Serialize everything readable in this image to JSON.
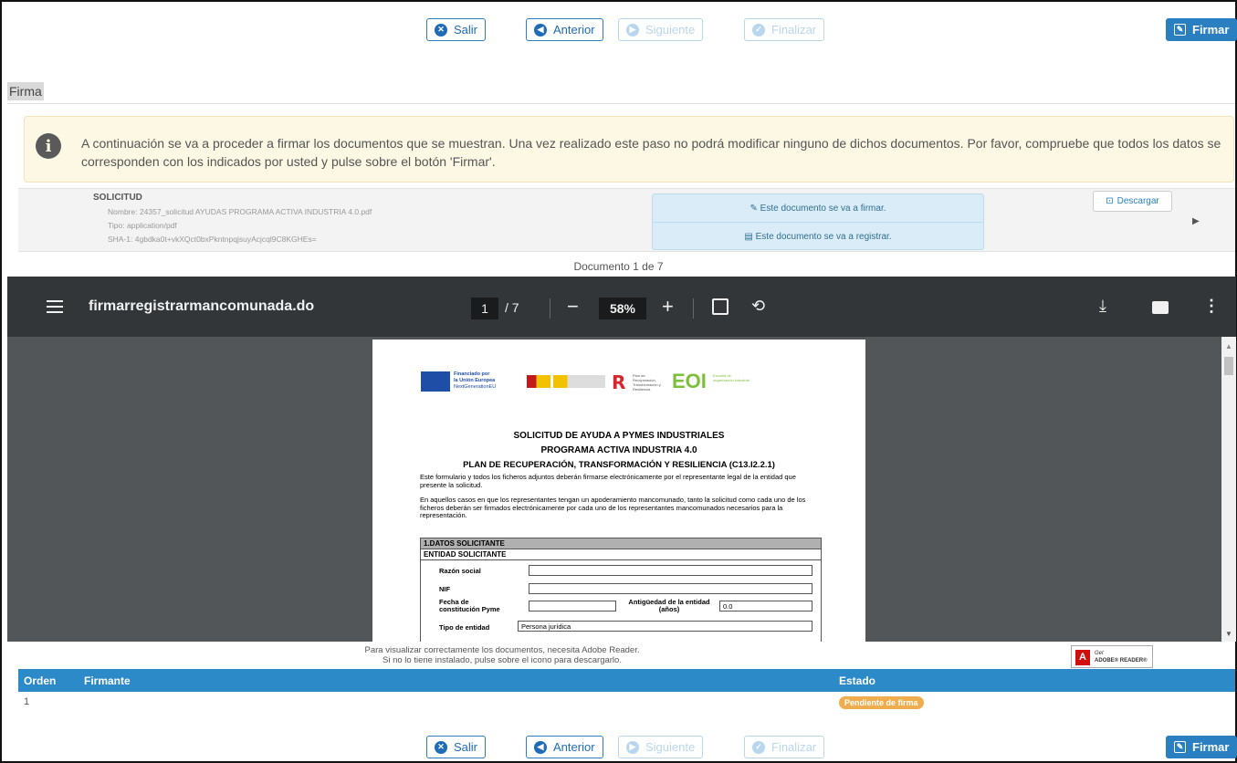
{
  "toolbar": {
    "salir": "Salir",
    "anterior": "Anterior",
    "siguiente": "Siguiente",
    "finalizar": "Finalizar",
    "firmar": "Firmar"
  },
  "section_title": "Firma",
  "alert_text": "A continuación se va a proceder a firmar los documentos que se muestran. Una vez realizado este paso no podrá modificar ninguno de dichos documentos. Por favor, compruebe que todos los datos se corresponden con los indicados por usted y pulse sobre el botón 'Firmar'.",
  "document": {
    "title": "SOLICITUD",
    "name": "Nombre: 24357_solicitud AYUDAS PROGRAMA ACTIVA INDUSTRIA 4.0.pdf",
    "type": "Tipo: application/pdf",
    "sha": "SHA-1: 4gbdka0t+vkXQct0bxPkntnpqjsuyAcjcql9C8KGHEs=",
    "sign_note": "Este documento se va a firmar.",
    "register_note": "Este documento se va a registrar.",
    "download": "Descargar"
  },
  "doc_counter": "Documento 1 de 7",
  "viewer": {
    "filename": "firmarregistrarmancomunada.do",
    "page": "1",
    "page_total": "/ 7",
    "zoom": "58%"
  },
  "pdf": {
    "eu_text_1": "Financiado por",
    "eu_text_2": "la Unión Europea",
    "eu_text_3": "NextGenerationEU",
    "tr_text": "Plan de Recuperación, Transformación y Resiliencia",
    "eoi_logo": "EOI",
    "eoi_text": "Escuela de organización industrial",
    "title1": "SOLICITUD DE AYUDA A PYMES INDUSTRIALES",
    "title2": "PROGRAMA ACTIVA INDUSTRIA 4.0",
    "title3": "PLAN DE RECUPERACIÓN, TRANSFORMACIÓN Y RESILIENCIA (C13.I2.2.1)",
    "para1": "Este formulario y todos los ficheros adjuntos deberán firmarse electrónicamente por el representante legal de la entidad que presente la solicitud.",
    "para2": "En aquellos casos en que los representantes tengan un apoderamiento mancomunado, tanto la solicitud como cada uno de los ficheros deberán ser firmados electrónicamente por cada uno de los representantes mancomunados necesarios para la representación.",
    "sec1": "1.DATOS SOLICITANTE",
    "sec2": "ENTIDAD SOLICITANTE",
    "razon": "Razón social",
    "nif": "NIF",
    "fecha": "Fecha de constitución Pyme",
    "antig": "Antigüedad de la entidad (años)",
    "antig_val": "0.0",
    "tipo": "Tipo de entidad",
    "tipo_val": "Persona jurídica"
  },
  "adobe_note_1": "Para visualizar correctamente los documentos, necesita Adobe Reader.",
  "adobe_note_2": "Si no lo tiene instalado, pulse sobre el icono para descargarlo.",
  "adobe_badge_1": "Get",
  "adobe_badge_2": "ADOBE® READER®",
  "signers": {
    "headers": [
      "Orden",
      "Firmante",
      "Estado"
    ],
    "rows": [
      {
        "orden": "1",
        "firmante": "",
        "estado": "Pendiente de firma"
      }
    ]
  }
}
